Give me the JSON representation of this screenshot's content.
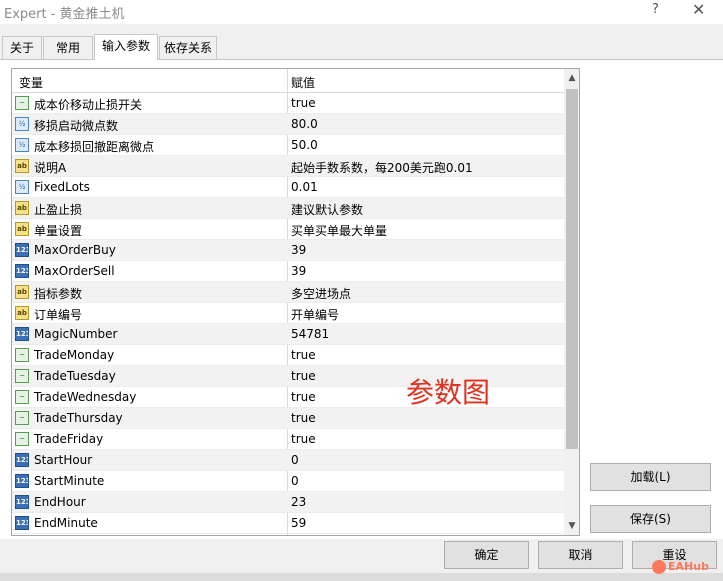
{
  "window": {
    "title": "Expert - 黄金推土机",
    "help_glyph": "?",
    "close_glyph": "✕"
  },
  "tabs": [
    {
      "label": "关于"
    },
    {
      "label": "常用"
    },
    {
      "label": "输入参数",
      "active": true
    },
    {
      "label": "依存关系"
    }
  ],
  "grid": {
    "columns": {
      "variable": "变量",
      "value": "赋值"
    },
    "rows": [
      {
        "icon": "bool",
        "icon_text": "~",
        "name": "成本价移动止损开关",
        "value": "true"
      },
      {
        "icon": "dbl",
        "icon_text": "½",
        "name": "移损启动微点数",
        "value": "80.0"
      },
      {
        "icon": "dbl",
        "icon_text": "½",
        "name": "成本移损回撤距离微点",
        "value": "50.0"
      },
      {
        "icon": "str",
        "icon_text": "ab",
        "name": "说明A",
        "value": "起始手数系数，每200美元跑0.01"
      },
      {
        "icon": "dbl",
        "icon_text": "½",
        "name": "FixedLots",
        "value": "0.01"
      },
      {
        "icon": "str",
        "icon_text": "ab",
        "name": "止盈止损",
        "value": "建议默认参数"
      },
      {
        "icon": "str",
        "icon_text": "ab",
        "name": "单量设置",
        "value": "买单买单最大单量"
      },
      {
        "icon": "int",
        "icon_text": "123",
        "name": "MaxOrderBuy",
        "value": "39"
      },
      {
        "icon": "int",
        "icon_text": "123",
        "name": "MaxOrderSell",
        "value": "39"
      },
      {
        "icon": "str",
        "icon_text": "ab",
        "name": "指标参数",
        "value": "多空进场点"
      },
      {
        "icon": "str",
        "icon_text": "ab",
        "name": "订单编号",
        "value": "开单编号"
      },
      {
        "icon": "int",
        "icon_text": "123",
        "name": "MagicNumber",
        "value": "54781"
      },
      {
        "icon": "bool",
        "icon_text": "~",
        "name": "TradeMonday",
        "value": "true"
      },
      {
        "icon": "bool",
        "icon_text": "~",
        "name": "TradeTuesday",
        "value": "true"
      },
      {
        "icon": "bool",
        "icon_text": "~",
        "name": "TradeWednesday",
        "value": "true"
      },
      {
        "icon": "bool",
        "icon_text": "~",
        "name": "TradeThursday",
        "value": "true"
      },
      {
        "icon": "bool",
        "icon_text": "~",
        "name": "TradeFriday",
        "value": "true"
      },
      {
        "icon": "int",
        "icon_text": "123",
        "name": "StartHour",
        "value": "0"
      },
      {
        "icon": "int",
        "icon_text": "123",
        "name": "StartMinute",
        "value": "0"
      },
      {
        "icon": "int",
        "icon_text": "123",
        "name": "EndHour",
        "value": "23"
      },
      {
        "icon": "int",
        "icon_text": "123",
        "name": "EndMinute",
        "value": "59"
      }
    ],
    "scroll_up_glyph": "▲",
    "scroll_down_glyph": "▼"
  },
  "overlay_text": "参数图",
  "buttons": {
    "load": "加载(L)",
    "save": "保存(S)",
    "ok": "确定",
    "cancel": "取消",
    "reset": "重设"
  },
  "watermark": "EAHub",
  "colors": {
    "overlay_red": "#e0301e",
    "header_gray": "#8a8a8a"
  }
}
